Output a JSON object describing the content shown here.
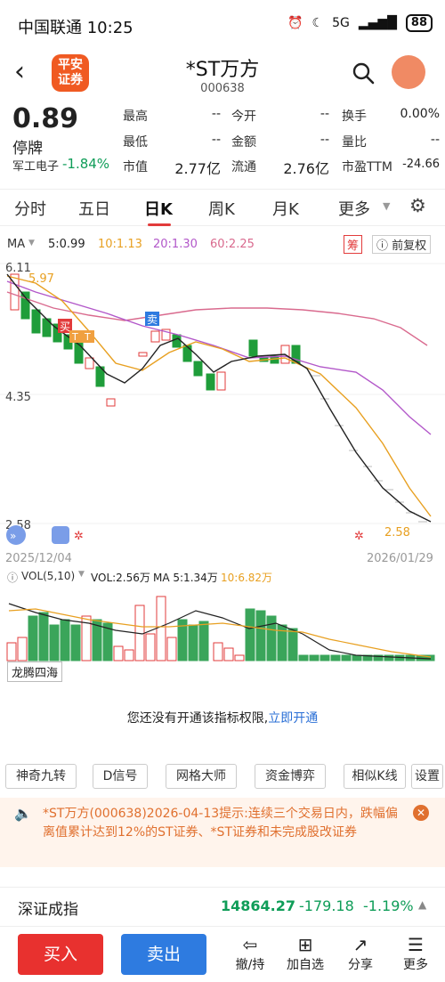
{
  "status": {
    "carrier_time": "中国联通 10:25",
    "battery": "88",
    "net": "5G"
  },
  "header": {
    "name": "*ST万方",
    "code": "000638",
    "logo_text": "平安\n证券"
  },
  "quote": {
    "price": "0.89",
    "state": "停牌",
    "sector": "军工电子",
    "sector_change": "-1.84%",
    "fields": [
      {
        "label": "最高",
        "value": "--"
      },
      {
        "label": "今开",
        "value": "--"
      },
      {
        "label": "换手",
        "value": "0.00%"
      },
      {
        "label": "最低",
        "value": "--"
      },
      {
        "label": "金额",
        "value": "--"
      },
      {
        "label": "量比",
        "value": "--"
      },
      {
        "label": "市值",
        "value": "2.77亿"
      },
      {
        "label": "流通",
        "value": "2.76亿"
      },
      {
        "label": "市盈TTM",
        "value": "-24.66"
      }
    ]
  },
  "tabs": [
    "分时",
    "五日",
    "日K",
    "周K",
    "月K",
    "更多"
  ],
  "ma": {
    "label": "MA",
    "ma5": "5:0.99",
    "ma10": "10:1.13",
    "ma20": "20:1.30",
    "ma60": "60:2.25",
    "chou": "筹",
    "fq": "前复权"
  },
  "chart_labels": {
    "y_high": "6.11",
    "y_mid": "4.35",
    "y_low": "2.58",
    "hi_mark": "5.97",
    "lo_mark": "2.58",
    "date_start": "2025/12/04",
    "date_end": "2026/01/29",
    "buy": "买",
    "sell": "卖",
    "t1": "T",
    "t2": "T"
  },
  "vol": {
    "label": "VOL(5,10)",
    "vol": "VOL:2.56万",
    "ma5": "MA 5:1.34万",
    "ma10": "10:6.82万",
    "indicator": "龙腾四海"
  },
  "permission": {
    "text": "您还没有开通该指标权限,",
    "link": "立即开通"
  },
  "chips": [
    "神奇九转",
    "D信号",
    "网格大师",
    "资金博弈",
    "相似K线",
    "设置"
  ],
  "notice": "*ST万方(000638)2026-04-13提示:连续三个交易日内，跌幅偏离值累计达到12%的ST证券、*ST证券和未完成股改证券",
  "index": {
    "name": "深证成指",
    "value": "14864.27",
    "change": "-179.18",
    "pct": "-1.19%"
  },
  "bottom": {
    "buy": "买入",
    "sell": "卖出",
    "items": [
      "撤/持",
      "加自选",
      "分享",
      "更多"
    ]
  },
  "colors": {
    "up": "#e23b3b",
    "down": "#1f9d3a",
    "ma5": "#222222",
    "ma10": "#e8a021",
    "ma20": "#b257c9",
    "ma60": "#d96a8e"
  }
}
